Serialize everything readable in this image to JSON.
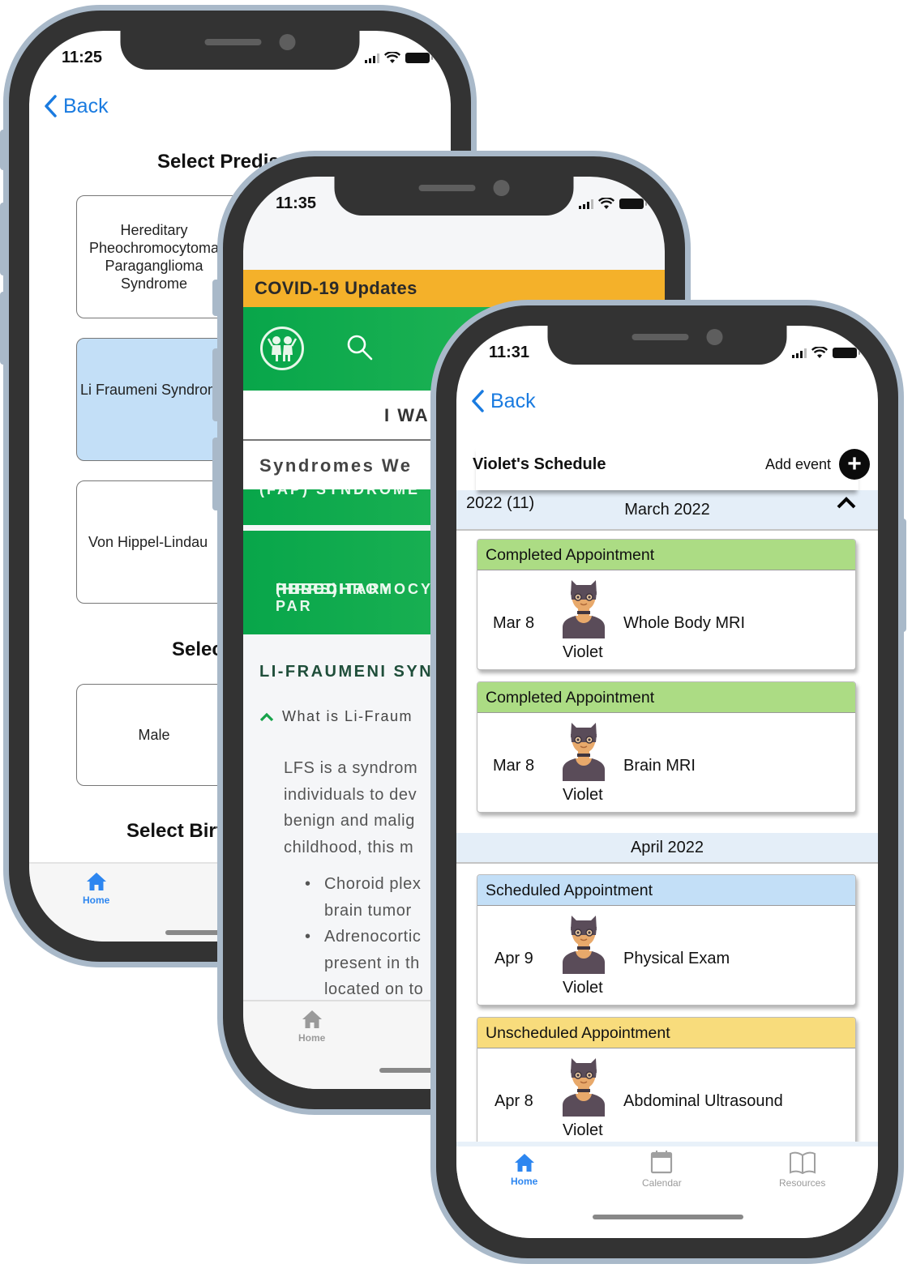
{
  "colors": {
    "ios_blue": "#1a7be0",
    "covid_orange": "#f4b12a",
    "brand_green": "#08a64a",
    "completed_green": "#acdc84",
    "scheduled_blue": "#c3dff7",
    "unscheduled_yellow": "#f8dc7c",
    "month_bar": "#e4eef8"
  },
  "phone_back": {
    "status_time": "11:25",
    "back_label": "Back",
    "title": "Select Predisposition",
    "options": [
      {
        "label": "Hereditary Pheochromocytoma Paraganglioma Syndrome",
        "selected": false
      },
      {
        "label": "Li Fraumeni Syndrome",
        "selected": true
      },
      {
        "label": "Von Hippel-Lindau",
        "selected": false
      }
    ],
    "section2_title": "Select Sex",
    "sex_options": [
      {
        "label": "Male",
        "selected": false
      }
    ],
    "section3_title": "Select Birth",
    "tabbar": {
      "home_label": "Home",
      "home_icon": "home-icon"
    }
  },
  "phone_middle": {
    "status_time": "11:35",
    "covid_banner": "COVID-19 Updates",
    "logo_icon": "children-logo-icon",
    "search_icon": "search-icon",
    "wa_label": "I WA",
    "syndromes_label": "Syndromes We",
    "fap_label": "(FAP) SYNDROME",
    "hpps_lines": [
      "HEREDITARY PAR",
      "PHEOCHROMOCY",
      "(HPPS)"
    ],
    "lfs_heading": "LI-FRAUMENI SYN",
    "faq_question": "What is Li-Fraum",
    "lfs_paragraph": [
      "LFS is a syndrom",
      "individuals to dev",
      "benign and malig",
      "childhood, this m"
    ],
    "lfs_bullets": [
      [
        "Choroid plex",
        "brain tumor"
      ],
      [
        "Adrenocortic",
        "present in th",
        "located on to"
      ]
    ],
    "tabbar": {
      "home_label": "Home",
      "home_icon": "home-icon"
    }
  },
  "phone_front": {
    "status_time": "11:31",
    "back_label": "Back",
    "title": "Violet's Schedule",
    "add_event_label": "Add event",
    "year_label": "2022 (11)",
    "months": [
      {
        "name": "March 2022",
        "expanded": true,
        "appointments": [
          {
            "status": "Completed Appointment",
            "date": "Mar 8",
            "person": "Violet",
            "title": "Whole Body MRI"
          },
          {
            "status": "Completed Appointment",
            "date": "Mar 8",
            "person": "Violet",
            "title": "Brain MRI"
          }
        ]
      },
      {
        "name": "April 2022",
        "appointments": [
          {
            "status": "Scheduled Appointment",
            "date": "Apr 9",
            "person": "Violet",
            "title": "Physical Exam"
          },
          {
            "status": "Unscheduled Appointment",
            "date": "Apr 8",
            "person": "Violet",
            "title": "Abdominal Ultrasound"
          }
        ]
      }
    ],
    "tabbar": [
      {
        "label": "Home",
        "icon": "home-icon",
        "active": true
      },
      {
        "label": "Calendar",
        "icon": "calendar-icon",
        "active": false
      },
      {
        "label": "Resources",
        "icon": "book-icon",
        "active": false
      }
    ]
  }
}
